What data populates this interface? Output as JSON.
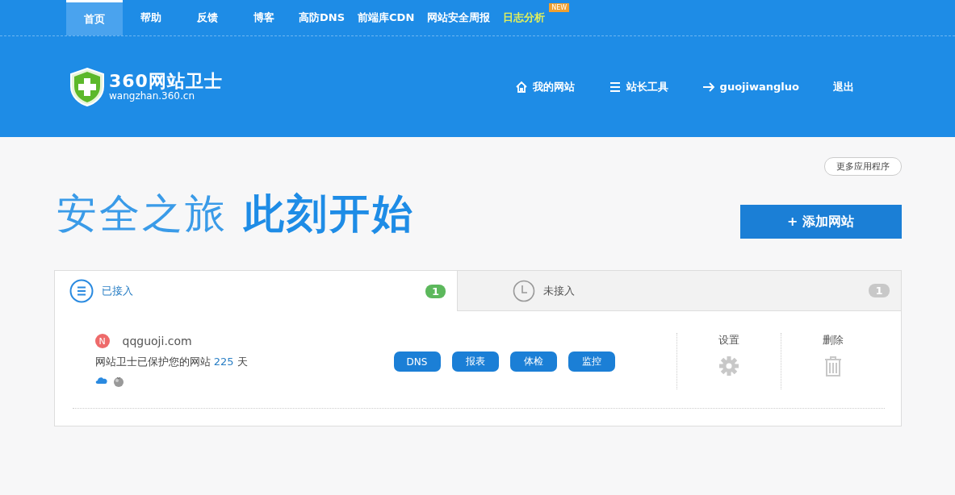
{
  "top_nav": [
    {
      "label": "首页",
      "selected": true,
      "highlighted": false
    },
    {
      "label": "帮助",
      "selected": false,
      "highlighted": false
    },
    {
      "label": "反馈",
      "selected": false,
      "highlighted": false
    },
    {
      "label": "博客",
      "selected": false,
      "highlighted": false
    },
    {
      "label": "高防DNS",
      "selected": false,
      "highlighted": false
    },
    {
      "label": "前端库CDN",
      "selected": false,
      "highlighted": false
    },
    {
      "label": "网站安全周报",
      "selected": false,
      "highlighted": false
    },
    {
      "label": "日志分析",
      "selected": false,
      "highlighted": true,
      "badge": "NEW"
    }
  ],
  "header": {
    "logo_title": "360网站卫士",
    "logo_url": "wangzhan.360.cn",
    "links": [
      {
        "label": "我的网站"
      },
      {
        "label": "站长工具"
      },
      {
        "label": "guojiwangluo"
      },
      {
        "label": "退出"
      }
    ]
  },
  "more_apps_button": "更多应用程序",
  "hero": {
    "light": "安全之旅",
    "bold": "此刻开始"
  },
  "add_site_button": "+ 添加网站",
  "tabs": [
    {
      "label": "已接入",
      "count": "1",
      "selected": true
    },
    {
      "label": "未接入",
      "count": "1",
      "selected": false
    }
  ],
  "sites": [
    {
      "initial": "N",
      "domain": "qqguoji.com",
      "protected_text": "网站卫士已保护您的网站",
      "days": "225",
      "days_unit": "天",
      "actions": [
        "DNS",
        "报表",
        "体检",
        "监控"
      ],
      "settings_label": "设置",
      "delete_label": "删除"
    }
  ]
}
